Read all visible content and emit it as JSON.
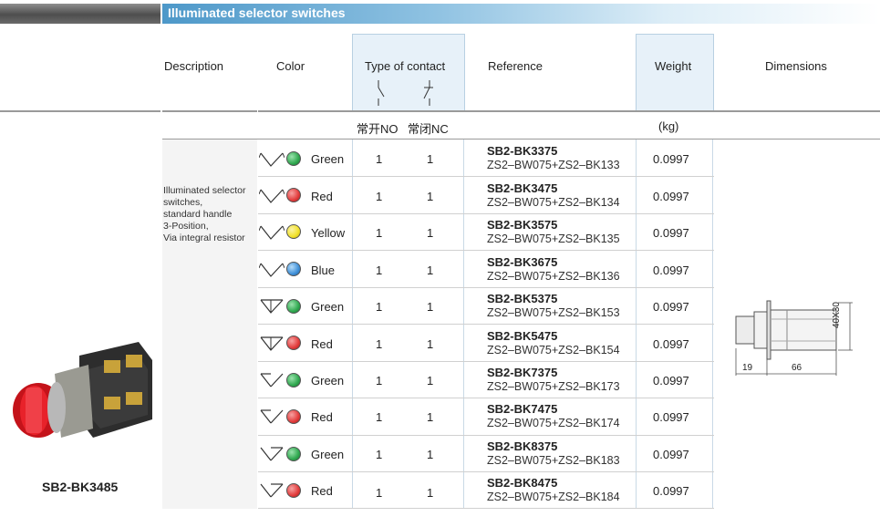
{
  "title": "Illuminated selector switches",
  "headers": {
    "description": "Description",
    "color": "Color",
    "contact": "Type of contact",
    "reference": "Reference",
    "weight": "Weight",
    "dimensions": "Dimensions",
    "no_label": "常开NO",
    "nc_label": "常闭NC",
    "weight_unit": "(kg)"
  },
  "description": [
    "Illuminated selector",
    "switches,",
    "standard handle",
    "3-Position,",
    "Via integral resistor"
  ],
  "product_label": "SB2-BK3485",
  "rows": [
    {
      "symbol": "two-way",
      "color": "Green",
      "hex": "#2fa84f",
      "no": "1",
      "nc": "1",
      "ref": "SB2-BK3375",
      "parts": "ZS2–BW075+ZS2–BK133",
      "weight": "0.0997"
    },
    {
      "symbol": "two-way",
      "color": "Red",
      "hex": "#e23b3b",
      "no": "1",
      "nc": "1",
      "ref": "SB2-BK3475",
      "parts": "ZS2–BW075+ZS2–BK134",
      "weight": "0.0997"
    },
    {
      "symbol": "two-way",
      "color": "Yellow",
      "hex": "#f2e12a",
      "no": "1",
      "nc": "1",
      "ref": "SB2-BK3575",
      "parts": "ZS2–BW075+ZS2–BK135",
      "weight": "0.0997"
    },
    {
      "symbol": "two-way",
      "color": "Blue",
      "hex": "#3e8fd8",
      "no": "1",
      "nc": "1",
      "ref": "SB2-BK3675",
      "parts": "ZS2–BW075+ZS2–BK136",
      "weight": "0.0997"
    },
    {
      "symbol": "return-both",
      "color": "Green",
      "hex": "#2fa84f",
      "no": "1",
      "nc": "1",
      "ref": "SB2-BK5375",
      "parts": "ZS2–BW075+ZS2–BK153",
      "weight": "0.0997"
    },
    {
      "symbol": "return-both",
      "color": "Red",
      "hex": "#e23b3b",
      "no": "1",
      "nc": "1",
      "ref": "SB2-BK5475",
      "parts": "ZS2–BW075+ZS2–BK154",
      "weight": "0.0997"
    },
    {
      "symbol": "return-left",
      "color": "Green",
      "hex": "#2fa84f",
      "no": "1",
      "nc": "1",
      "ref": "SB2-BK7375",
      "parts": "ZS2–BW075+ZS2–BK173",
      "weight": "0.0997"
    },
    {
      "symbol": "return-left",
      "color": "Red",
      "hex": "#e23b3b",
      "no": "1",
      "nc": "1",
      "ref": "SB2-BK7475",
      "parts": "ZS2–BW075+ZS2–BK174",
      "weight": "0.0997"
    },
    {
      "symbol": "return-right",
      "color": "Green",
      "hex": "#2fa84f",
      "no": "1",
      "nc": "1",
      "ref": "SB2-BK8375",
      "parts": "ZS2–BW075+ZS2–BK183",
      "weight": "0.0997"
    },
    {
      "symbol": "return-right",
      "color": "Red",
      "hex": "#e23b3b",
      "no": "1",
      "nc": "1",
      "ref": "SB2-BK8475",
      "parts": "ZS2–BW075+ZS2–BK184",
      "weight": "0.0997"
    }
  ],
  "dimensions": {
    "d1": "19",
    "d2": "66",
    "d3": "40X30"
  }
}
